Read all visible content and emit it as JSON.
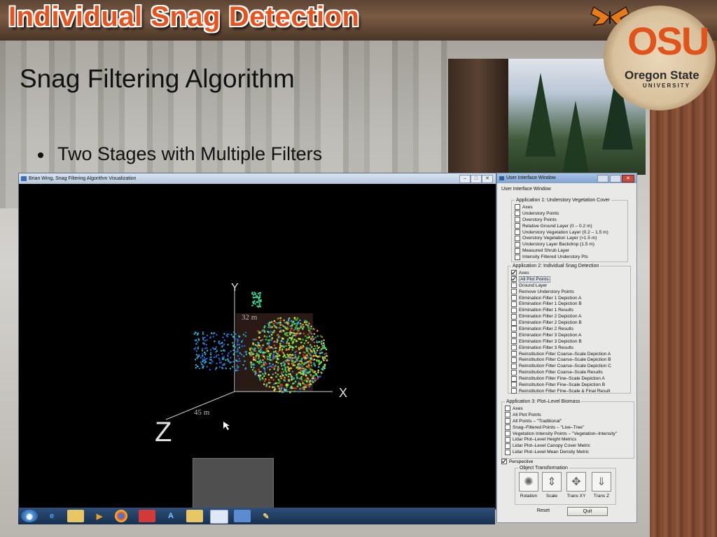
{
  "banner": {
    "title": "Individual Snag Detection"
  },
  "logo": {
    "big": "OSU",
    "small": "Oregon State",
    "univ": "UNIVERSITY"
  },
  "slide": {
    "title": "Snag Filtering Algorithm",
    "bullet": "Two Stages with Multiple Filters"
  },
  "viz_window": {
    "title": "Brian Wing, Snag Filtering Algorithm Visualization",
    "axis_y": "Y",
    "axis_x": "X",
    "axis_z": "Z",
    "label_32": "32 m",
    "label_45": "45 m"
  },
  "ui_window": {
    "title": "User Interface Window",
    "header": "User Interface Window",
    "app1": {
      "legend": "Application 1: Understory Vegetation Cover",
      "items": [
        {
          "label": "Axes",
          "checked": false
        },
        {
          "label": "Understory Points",
          "checked": false
        },
        {
          "label": "Overstory Points",
          "checked": false
        },
        {
          "label": "Relative Ground Layer (0 – 0.2 m)",
          "checked": false
        },
        {
          "label": "Understory Vegetation Layer (0.2 – 1.5 m)",
          "checked": false
        },
        {
          "label": "Overstory Vegetation Layer (>1.5 m)",
          "checked": false
        },
        {
          "label": "Understory Layer Backdrop (1.5 m)",
          "checked": false
        },
        {
          "label": "Measured Shrub Layer",
          "checked": false
        },
        {
          "label": "Intensity Filtered Understory Pts",
          "checked": false
        }
      ]
    },
    "app2": {
      "legend": "Application 2: Individual Snag Detection",
      "items": [
        {
          "label": "Axes",
          "checked": true
        },
        {
          "label": "All Plot Points",
          "checked": true
        },
        {
          "label": "Ground Layer",
          "checked": false
        },
        {
          "label": "Remove Understory Points",
          "checked": false
        },
        {
          "label": "Elimination Filter 1 Depiction A",
          "checked": false
        },
        {
          "label": "Elimination Filter 1 Depiction B",
          "checked": false
        },
        {
          "label": "Elimination Filter 1 Results",
          "checked": false
        },
        {
          "label": "Elimination Filter 2 Depiction A",
          "checked": false
        },
        {
          "label": "Elimination Filter 2 Depiction B",
          "checked": false
        },
        {
          "label": "Elimination Filter 2 Results",
          "checked": false
        },
        {
          "label": "Elimination Filter 3 Depiction A",
          "checked": false
        },
        {
          "label": "Elimination Filter 3 Depiction B",
          "checked": false
        },
        {
          "label": "Elimination Filter 3 Results",
          "checked": false
        },
        {
          "label": "Reinstitution Filter Coarse–Scale Depiction A",
          "checked": false
        },
        {
          "label": "Reinstitution Filter Coarse–Scale Depiction B",
          "checked": false
        },
        {
          "label": "Reinstitution Filter Coarse–Scale Depiction C",
          "checked": false
        },
        {
          "label": "Reinstitution Filter Coarse–Scale Results",
          "checked": false
        },
        {
          "label": "Reinstitution Filter Fine–Scale Depiction A",
          "checked": false
        },
        {
          "label": "Reinstitution Filter Fine–Scale Depiction B",
          "checked": false
        },
        {
          "label": "Reinstitution Filter Fine–Scale & Final Result",
          "checked": false
        }
      ]
    },
    "app3": {
      "legend": "Application 3: Plot–Level Biomass",
      "items": [
        {
          "label": "Axes",
          "checked": false
        },
        {
          "label": "All Plot Points",
          "checked": false
        },
        {
          "label": "All Points – \"Traditional\"",
          "checked": false
        },
        {
          "label": "Snag–Filtered Points – \"Live–Tree\"",
          "checked": false
        },
        {
          "label": "Vegetation Intensity Points – \"Vegetation–Intensity\"",
          "checked": false
        },
        {
          "label": "Lidar Plot–Level Height Metrics",
          "checked": false
        },
        {
          "label": "Lidar Plot–Level Canopy Cover Metric",
          "checked": false
        },
        {
          "label": "Lidar Plot–Level Mean Density Metric",
          "checked": false
        }
      ]
    },
    "perspective": {
      "label": "Perspective",
      "checked": true
    },
    "transform": {
      "legend": "Object Transformation",
      "tools": [
        {
          "label": "Rotation",
          "icon": "rotation-icon"
        },
        {
          "label": "Scale",
          "icon": "scale-icon"
        },
        {
          "label": "Trans XY",
          "icon": "trans-xy-icon"
        },
        {
          "label": "Trans Z",
          "icon": "trans-z-icon"
        }
      ]
    },
    "reset_label": "Reset",
    "quit_label": "Quit"
  },
  "taskbar": {
    "icons": [
      "start-orb-icon",
      "ie-icon",
      "explorer-icon",
      "media-player-icon",
      "chrome-icon",
      "app-icon-red",
      "app-icon-a",
      "app-icon-folder",
      "app-icon-window",
      "app-icon-save",
      "app-icon-pen"
    ]
  }
}
